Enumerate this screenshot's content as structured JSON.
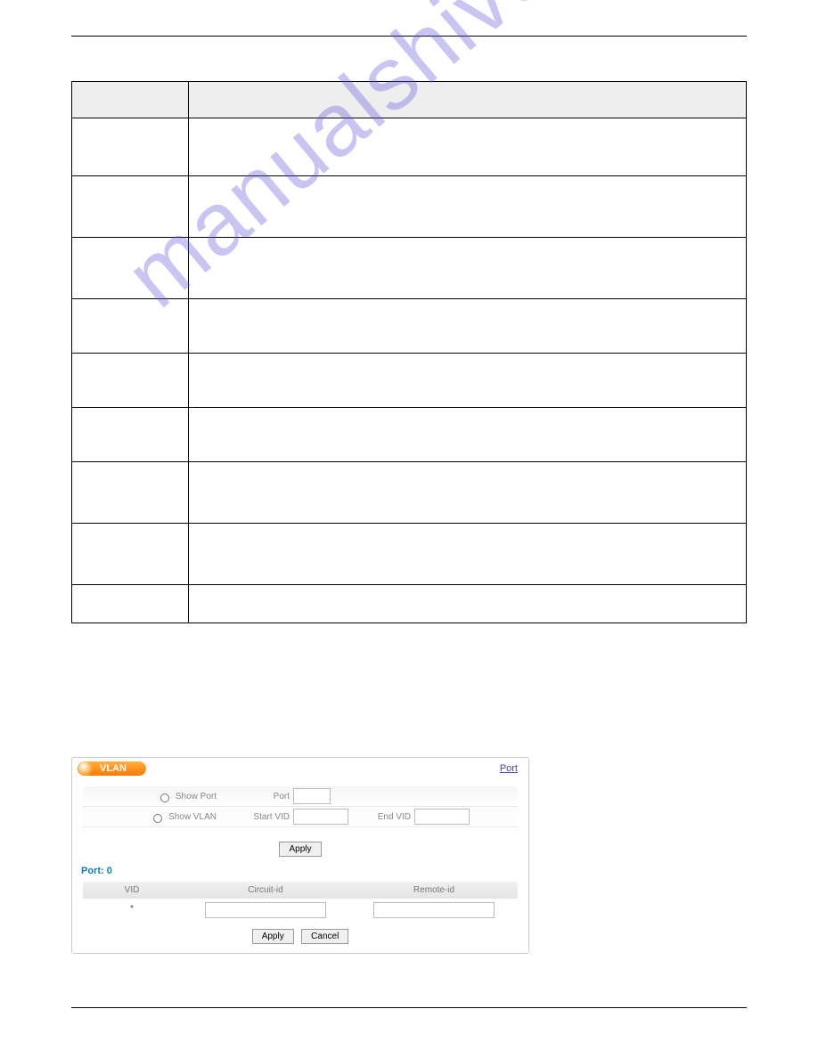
{
  "watermark": "manualshive.com",
  "table": {
    "headers": [
      "",
      ""
    ]
  },
  "vlan": {
    "tab_label": "VLAN",
    "port_link": "Port",
    "show_port_label": "Show Port",
    "show_vlan_label": "Show VLAN",
    "port_field_label": "Port",
    "start_vid_label": "Start VID",
    "end_vid_label": "End VID",
    "apply_label": "Apply",
    "cancel_label": "Cancel",
    "port_section_label": "Port: 0",
    "col_vid": "VID",
    "col_circuit": "Circuit-id",
    "col_remote": "Remote-id",
    "row_vid_value": "*"
  }
}
